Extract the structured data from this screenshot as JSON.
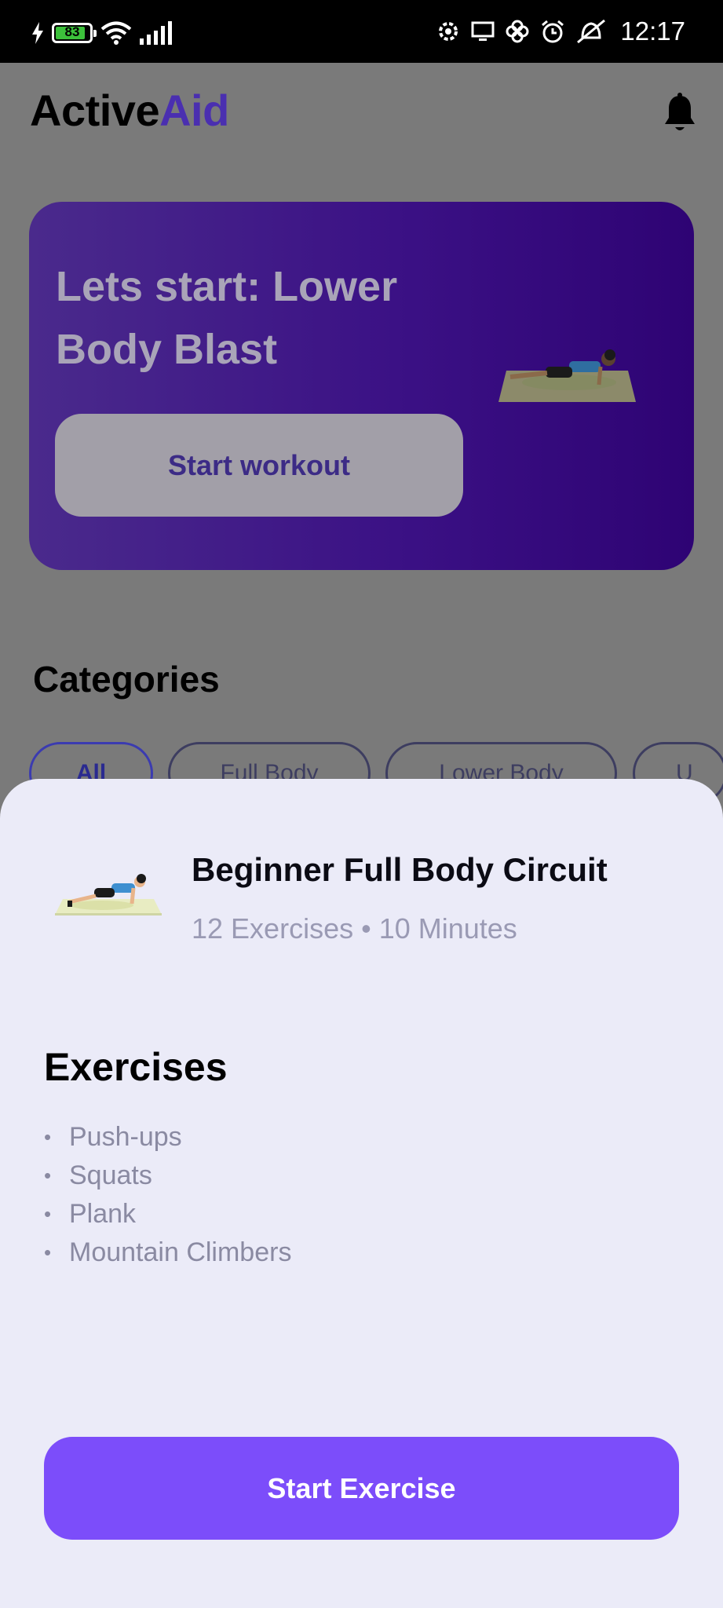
{
  "status_bar": {
    "battery_level": "83",
    "time": "12:17",
    "icons": [
      "charging-icon",
      "battery-icon",
      "wifi-icon",
      "signal-icon",
      "settings-icon",
      "screen-cast-icon",
      "fan-icon",
      "alarm-icon",
      "alarm-off-icon"
    ]
  },
  "header": {
    "title_part1": "Active",
    "title_part2": "Aid",
    "bell_icon": "bell-icon"
  },
  "banner": {
    "title": "Lets start: Lower Body Blast",
    "button_label": "Start workout"
  },
  "categories": {
    "title": "Categories",
    "chips": [
      "All",
      "Full Body",
      "Lower Body",
      "U"
    ]
  },
  "sheet": {
    "workout_title": "Beginner Full Body Circuit",
    "workout_meta": "12 Exercises • 10 Minutes",
    "exercises_title": "Exercises",
    "exercises": [
      "Push-ups",
      "Squats",
      "Plank",
      "Mountain Climbers"
    ],
    "start_button": "Start Exercise"
  },
  "colors": {
    "accent": "#7c4dfa",
    "brand_dim": "#4a2fb0",
    "sheet_bg": "#ebebf8",
    "overlay": "#7a7a7a"
  }
}
